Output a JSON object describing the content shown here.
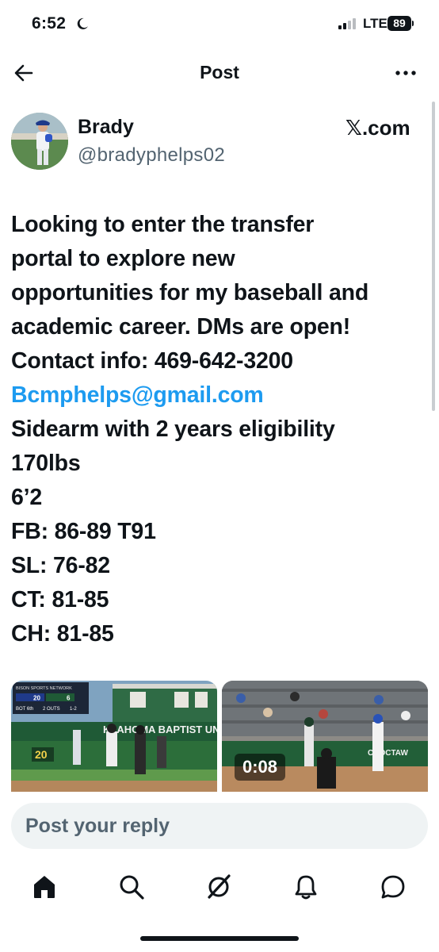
{
  "status_bar": {
    "time": "6:52",
    "network": "LTE",
    "battery": "89"
  },
  "header": {
    "title": "Post"
  },
  "author": {
    "name": "Brady",
    "handle": "@bradyphelps02",
    "source": "𝕏.com"
  },
  "post": {
    "lines": [
      "Looking to enter the transfer",
      "portal to explore new",
      "opportunities for my baseball and",
      "academic career. DMs are open!",
      "Contact info: 469-642-3200",
      "Bcmphelps@gmail.com",
      "Sidearm with 2 years eligibility",
      "170lbs",
      "6’2",
      "FB: 86-89 T91",
      "SL: 76-82",
      "CT: 81-85",
      "CH: 81-85"
    ],
    "email": "Bcmphelps@gmail.com"
  },
  "media": {
    "video_1": {
      "scoreboard_network": "BISON SPORTS NETWORK",
      "scoreboard_inning": "BOT 6th",
      "scoreboard_outs": "2 OUTS",
      "scoreboard_count": "1-2",
      "score_away": "20",
      "score_home": "6",
      "banner": "KLAHOMA BAPTIST UNI",
      "wall_number": "20"
    },
    "video_2": {
      "duration": "0:08",
      "banner": "CHOCTAW"
    }
  },
  "reply": {
    "placeholder": "Post your reply"
  },
  "nav": {
    "items": [
      "home",
      "search",
      "grok",
      "notifications",
      "messages"
    ]
  },
  "colors": {
    "link": "#1d9bf0",
    "text": "#0f1419",
    "secondary": "#536471",
    "input_bg": "#eff3f4"
  }
}
